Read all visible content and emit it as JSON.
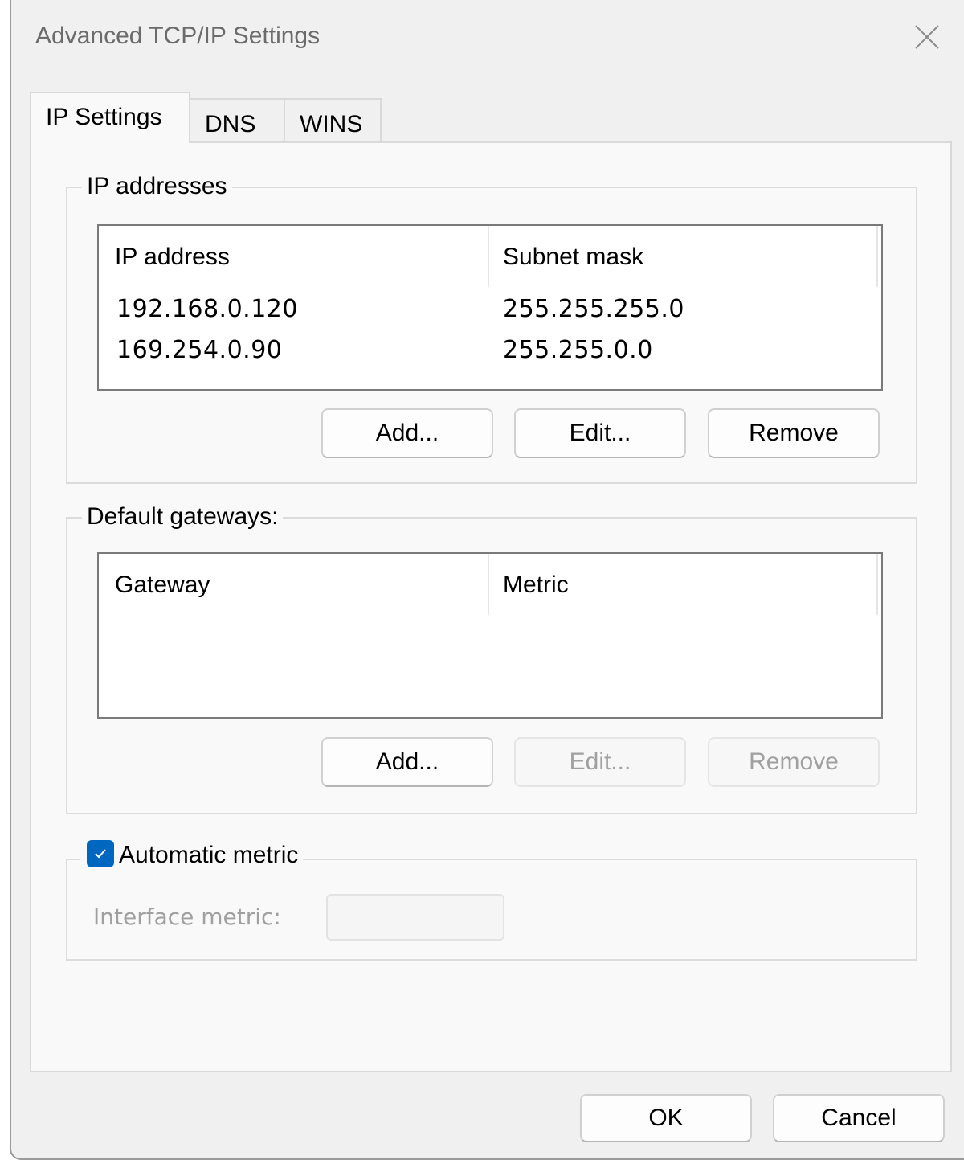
{
  "window": {
    "title": "Advanced TCP/IP Settings",
    "close_icon": "close-icon"
  },
  "tabs": [
    {
      "label": "IP Settings",
      "active": true
    },
    {
      "label": "DNS",
      "active": false
    },
    {
      "label": "WINS",
      "active": false
    }
  ],
  "ip_addresses": {
    "legend": "IP addresses",
    "columns": [
      "IP address",
      "Subnet mask"
    ],
    "rows": [
      {
        "ip": "192.168.0.120",
        "mask": "255.255.255.0"
      },
      {
        "ip": "169.254.0.90",
        "mask": "255.255.0.0"
      }
    ],
    "buttons": {
      "add": "Add...",
      "edit": "Edit...",
      "remove": "Remove"
    }
  },
  "gateways": {
    "legend": "Default gateways:",
    "columns": [
      "Gateway",
      "Metric"
    ],
    "rows": [],
    "buttons": {
      "add": "Add...",
      "edit": "Edit...",
      "remove": "Remove"
    }
  },
  "metric": {
    "checkbox_label": "Automatic metric",
    "checked": true,
    "interface_label": "Interface metric:",
    "interface_value": ""
  },
  "footer": {
    "ok": "OK",
    "cancel": "Cancel"
  },
  "colors": {
    "accent": "#0067c0",
    "disabled_text": "#a0a0a0"
  }
}
